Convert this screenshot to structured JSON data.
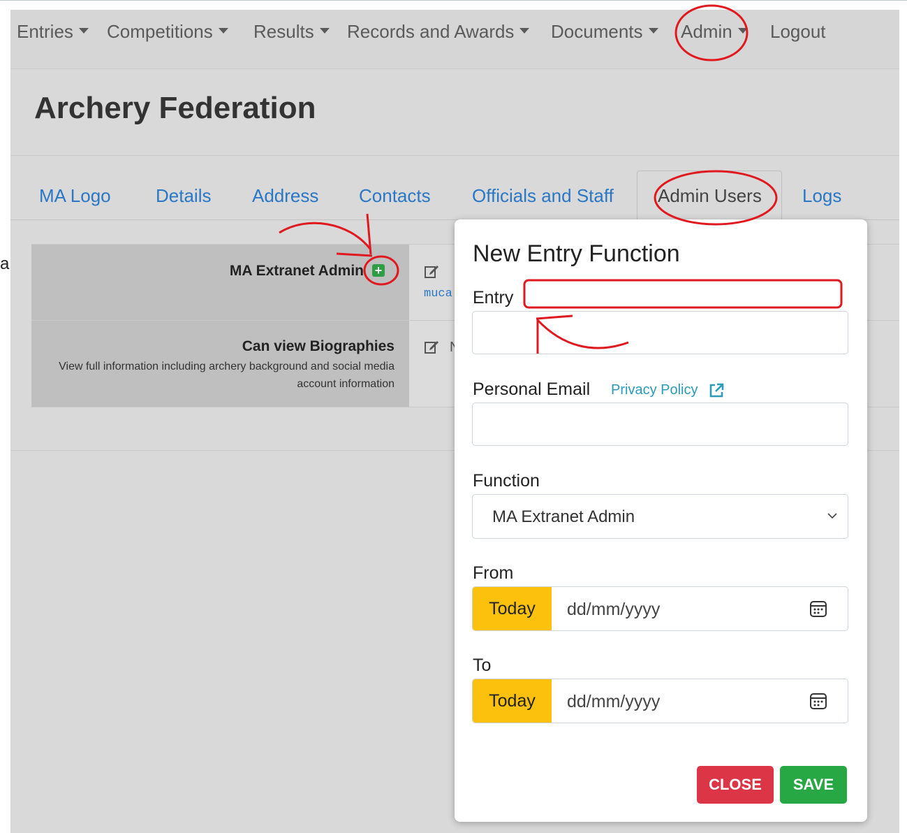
{
  "nav": {
    "items": [
      {
        "label": "Entries",
        "dropdown": true
      },
      {
        "label": "Competitions",
        "dropdown": true
      },
      {
        "label": "Results",
        "dropdown": true
      },
      {
        "label": "Records and Awards",
        "dropdown": true
      },
      {
        "label": "Documents",
        "dropdown": true
      },
      {
        "label": "Admin",
        "dropdown": true
      },
      {
        "label": "Logout",
        "dropdown": false
      }
    ]
  },
  "left_fragment": "a",
  "page_title": "Archery Federation",
  "tabs": [
    "MA Logo",
    "Details",
    "Address",
    "Contacts",
    "Officials and Staff",
    "Admin Users",
    "Logs"
  ],
  "active_tab": "Admin Users",
  "table": {
    "rows": [
      {
        "title": "MA Extranet Admin",
        "description": "",
        "value_fragment": "muca"
      },
      {
        "title": "Can view Biographies",
        "description": "View full information including archery background and social media account information",
        "value_fragment": "N"
      }
    ]
  },
  "modal": {
    "title": "New Entry Function",
    "entry_label": "Entry",
    "entry_value": "",
    "email_label": "Personal Email",
    "privacy_link": "Privacy Policy",
    "email_value": "",
    "function_label": "Function",
    "function_selected": "MA Extranet Admin",
    "from_label": "From",
    "to_label": "To",
    "today_label": "Today",
    "date_placeholder": "dd/mm/yyyy",
    "close_label": "CLOSE",
    "save_label": "SAVE"
  },
  "colors": {
    "link": "#2a77c6",
    "today": "#fcc10c",
    "close": "#dc3545",
    "save": "#28a745",
    "annotation": "#e0191f"
  }
}
